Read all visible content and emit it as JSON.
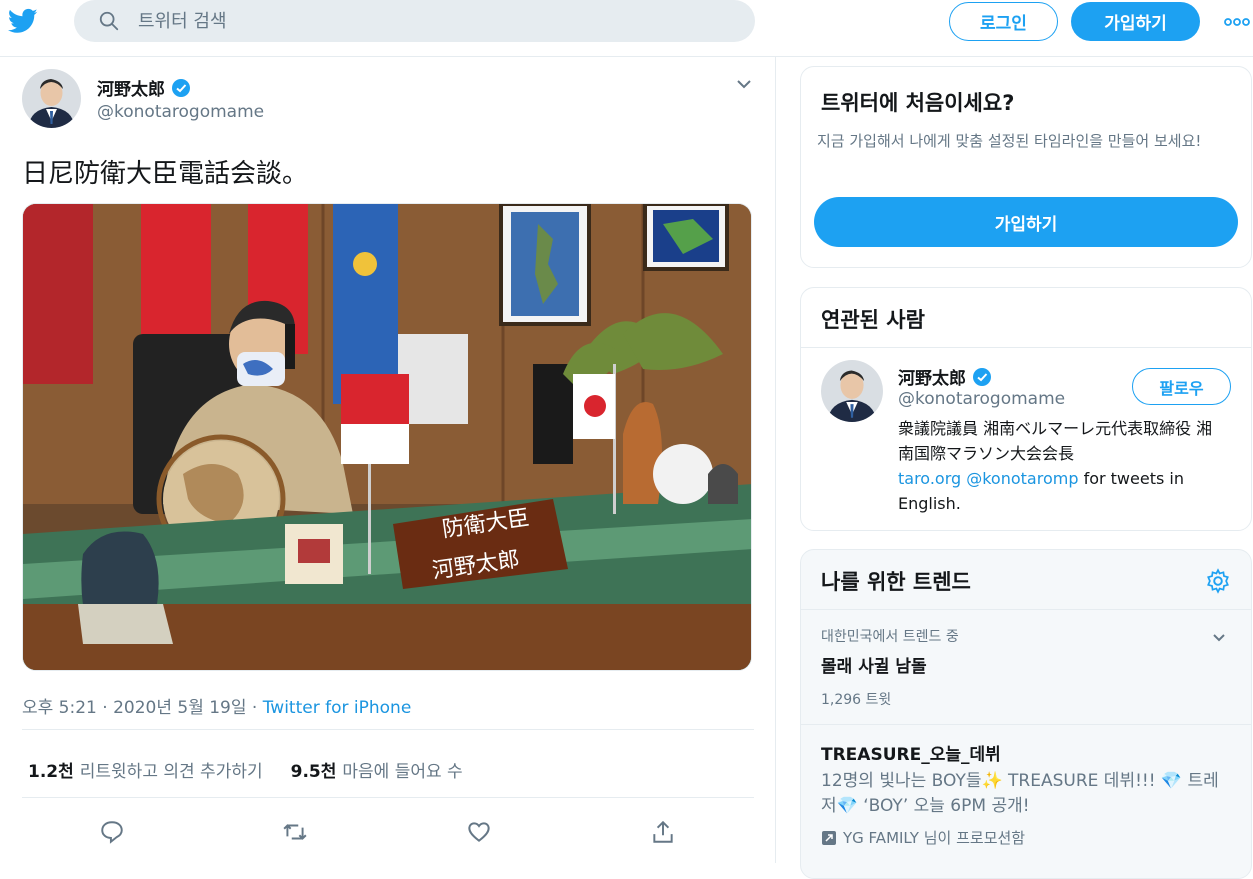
{
  "header": {
    "search_placeholder": "트위터 검색",
    "login_label": "로그인",
    "signup_label": "가입하기",
    "accent": "#1da1f2"
  },
  "tweet": {
    "name": "河野太郎",
    "handle": "@konotarogomame",
    "text": "日尼防衛大臣電話会談。",
    "time": "오후 5:21 · 2020년 5월 19일 · ",
    "source": "Twitter for iPhone",
    "retweets_count": "1.2천",
    "retweets_label": "리트윗하고 의견 추가하기",
    "likes_count": "9.5천",
    "likes_label": "마음에 들어요 수"
  },
  "new_card": {
    "title": "트위터에 처음이세요?",
    "desc": "지금 가입해서 나에게 맞춤 설정된 타임라인을 만들어 보세요!",
    "button": "가입하기"
  },
  "related": {
    "title": "연관된 사람",
    "name": "河野太郎",
    "handle": "@konotarogomame",
    "follow": "팔로우",
    "bio_1": "衆議院議員 湘南ベルマーレ元代表取締役 湘南国際マラソン大会会長",
    "link_1": "taro.org",
    "link_2": "@konotaromp",
    "bio_2": " for tweets in English."
  },
  "trends": {
    "title": "나를 위한 트렌드",
    "items": [
      {
        "context": "대한민국에서 트렌드 중",
        "title": "몰래 사귈 남돌",
        "count": "1,296 트윗"
      },
      {
        "title": "TREASURE_오늘_데뷔",
        "desc": "12명의 빛나는 BOY들✨ TREASURE 데뷔!!! 💎 트레저💎 ‘BOY’ 오늘 6PM 공개!",
        "promo": "YG FAMILY 님이 프로모션함"
      }
    ]
  }
}
